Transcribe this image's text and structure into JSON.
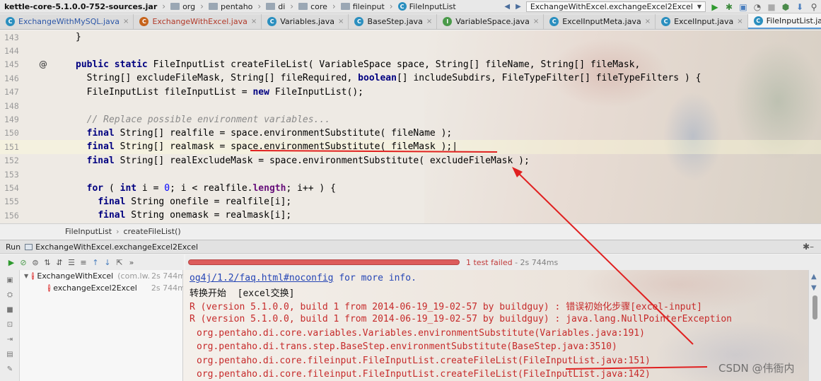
{
  "navbar": {
    "crumbs": [
      "kettle-core-5.1.0.0-752-sources.jar",
      "org",
      "pentaho",
      "di",
      "core",
      "fileinput",
      "FileInputList"
    ],
    "run_config": "ExchangeWithExcel.exchangeExcel2Excel"
  },
  "tabs": [
    {
      "label": "ExchangeWithMySQL.java",
      "icon": "class-icon",
      "style": "blue"
    },
    {
      "label": "ExchangeWithExcel.java",
      "icon": "class-icon",
      "style": "red"
    },
    {
      "label": "Variables.java",
      "icon": "class-icon",
      "style": "normal"
    },
    {
      "label": "BaseStep.java",
      "icon": "class-icon",
      "style": "normal"
    },
    {
      "label": "VariableSpace.java",
      "icon": "interface-icon",
      "style": "normal"
    },
    {
      "label": "ExcelInputMeta.java",
      "icon": "class-icon",
      "style": "normal"
    },
    {
      "label": "ExcelInput.java",
      "icon": "class-icon",
      "style": "normal"
    },
    {
      "label": "FileInputList.java",
      "icon": "class-icon",
      "style": "normal",
      "active": true
    }
  ],
  "editor": {
    "lines": [
      {
        "n": "143",
        "text": "}"
      },
      {
        "n": "144",
        "text": ""
      },
      {
        "n": "145",
        "text": "public static FileInputList createFileList( VariableSpace space, String[] fileName, String[] fileMask,"
      },
      {
        "n": "146",
        "text": "  String[] excludeFileMask, String[] fileRequired, boolean[] includeSubdirs, FileTypeFilter[] fileTypeFilters ) {"
      },
      {
        "n": "147",
        "text": "  FileInputList fileInputList = new FileInputList();"
      },
      {
        "n": "148",
        "text": ""
      },
      {
        "n": "149",
        "text": "  // Replace possible environment variables..."
      },
      {
        "n": "150",
        "text": "  final String[] realfile = space.environmentSubstitute( fileName );"
      },
      {
        "n": "151",
        "text": "  final String[] realmask = space.environmentSubstitute( fileMask );"
      },
      {
        "n": "152",
        "text": "  final String[] realExcludeMask = space.environmentSubstitute( excludeFileMask );"
      },
      {
        "n": "153",
        "text": ""
      },
      {
        "n": "154",
        "text": "  for ( int i = 0; i < realfile.length; i++ ) {"
      },
      {
        "n": "155",
        "text": "    final String onefile = realfile[i];"
      },
      {
        "n": "156",
        "text": "    final String onemask = realmask[i];"
      }
    ],
    "breadcrumb": [
      "FileInputList",
      "createFileList()"
    ]
  },
  "run": {
    "title": "Run",
    "config": "ExchangeWithExcel.exchangeExcel2Excel",
    "status": "1 test failed",
    "duration": "- 2s 744ms",
    "progress_failed": 1.0,
    "tree": [
      {
        "label": "ExchangeWithExcel",
        "pkg": "(com.lw.",
        "time": "2s 744ms",
        "level": 0
      },
      {
        "label": "exchangeExcel2Excel",
        "time": "2s 744ms",
        "level": 1
      }
    ]
  },
  "console": {
    "lines": [
      {
        "text": "og4j/1.2/faq.html#noconfig",
        "suffix": " for more info.",
        "style": "link"
      },
      {
        "text": "转换开始  [excel交换]",
        "style": "black"
      },
      {
        "text": "R (version 5.1.0.0, build 1 from 2014-06-19_19-02-57 by buildguy) : 错误初始化步骤[excel-input]",
        "style": "error"
      },
      {
        "text": "R (version 5.1.0.0, build 1 from 2014-06-19_19-02-57 by buildguy) : java.lang.NullPointerException",
        "style": "error"
      },
      {
        "text": "org.pentaho.di.core.variables.Variables.environmentSubstitute(Variables.java:191)",
        "style": "error-indent"
      },
      {
        "text": "org.pentaho.di.trans.step.BaseStep.environmentSubstitute(BaseStep.java:3510)",
        "style": "error-indent"
      },
      {
        "text": "org.pentaho.di.core.fileinput.FileInputList.createFileList(FileInputList.java:151)",
        "style": "error-indent"
      },
      {
        "text": "org.pentaho.di.core.fileinput.FileInputList.createFileList(FileInputList.java:142)",
        "style": "error-indent"
      }
    ]
  },
  "watermark": "CSDN @伟衙内",
  "colors": {
    "keyword": "#000080",
    "error_text": "#c62a2a",
    "link": "#2545b5",
    "progress_fail": "#dc5b5b",
    "annotation": "#e02020"
  }
}
